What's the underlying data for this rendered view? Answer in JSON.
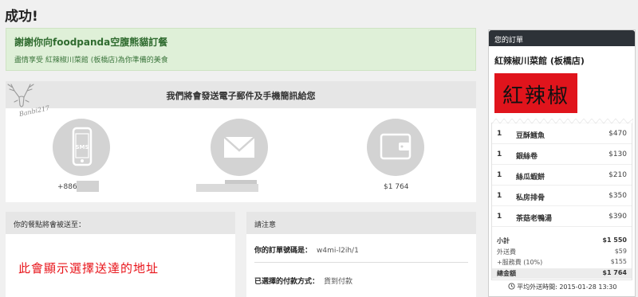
{
  "page_title": "成功!",
  "success": {
    "title": "謝謝你向foodpanda空腹熊貓訂餐",
    "subtitle": "盡情享受 紅辣椒川菜館 (板橋店)為你準備的美食"
  },
  "watermark_text": "Banbi217",
  "notify": {
    "title": "我們將會發送電子郵件及手機簡訊給您",
    "sms_label": "SMS",
    "phone_prefix": "+886",
    "amount": "$1 764"
  },
  "address": {
    "header": "你的餐點將會被送至：",
    "placeholder_text": "此會顯示選擇送達的地址"
  },
  "note": {
    "header": "請注意",
    "order_no_label": "你的訂單號碼是：",
    "order_no": "w4mi-l2ih/1",
    "payment_label": "已選擇的付款方式：",
    "payment": "貨到付款"
  },
  "order": {
    "header": "您的訂單",
    "restaurant": "紅辣椒川菜館 (板橋店)",
    "logo_text": "紅辣椒",
    "items": [
      {
        "qty": "1",
        "name": "豆酥鱈魚",
        "price": "$470"
      },
      {
        "qty": "1",
        "name": "銀絲卷",
        "price": "$130"
      },
      {
        "qty": "1",
        "name": "絲瓜蝦餅",
        "price": "$210"
      },
      {
        "qty": "1",
        "name": "私房排骨",
        "price": "$350"
      },
      {
        "qty": "1",
        "name": "茶菇老鴨湯",
        "price": "$390"
      }
    ],
    "subtotal_label": "小計",
    "subtotal": "$1 550",
    "delivery_label": "外送費",
    "delivery": "$59",
    "service_label": "+服務費 (10%)",
    "service": "$155",
    "total_label": "總金額",
    "total": "$1 764",
    "delivery_time": "平均外送時間: 2015-01-28 13:30"
  },
  "colors": {
    "success_bg": "#dff0d8",
    "order_header": "#2d3238",
    "logo_bg": "#e0141c",
    "address_text": "#e8141a"
  }
}
